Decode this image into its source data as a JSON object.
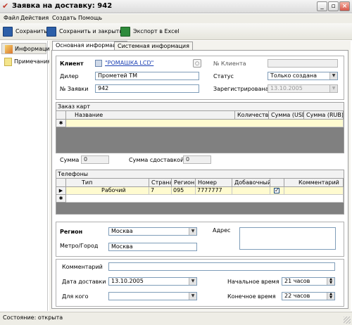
{
  "window": {
    "title": "Заявка на доставку: 942"
  },
  "menu": [
    "Файл",
    "Действия",
    "Создать",
    "Помощь"
  ],
  "toolbar": {
    "save": "Сохранить",
    "save_close": "Сохранить и закрыть",
    "export": "Экспорт в Excel"
  },
  "nav": {
    "items": [
      {
        "label": "Информация"
      },
      {
        "label": "Примечания"
      }
    ]
  },
  "tabs": [
    "Основная информация",
    "Системная информация"
  ],
  "main": {
    "client_label": "Клиент",
    "client_value": "\"РОМАШКА LCD\"",
    "client_no_label": "№ Клиента",
    "client_no_value": "",
    "dealer_label": "Дилер",
    "dealer_value": "Прометей ТМ",
    "status_label": "Статус",
    "status_value": "Только создана",
    "order_no_label": "№ Заявки",
    "order_no_value": "942",
    "registered_label": "Зарегистрирована",
    "registered_value": "13.10.2005"
  },
  "cards": {
    "caption": "Заказ карт",
    "columns": [
      "Название",
      "Количество",
      "Сумма (USD)",
      "Сумма (RUB)"
    ],
    "new_row_marker": "✱"
  },
  "sums": {
    "sum_label": "Сумма",
    "sum_value": "0",
    "delivery_label": "Сумма сдоставкой",
    "delivery_value": "0"
  },
  "phones": {
    "caption": "Телефоны",
    "columns": [
      "Тип",
      "Страна",
      "Регион",
      "Номер",
      "Добавочный",
      "",
      "Комментарий"
    ],
    "rows": [
      {
        "type": "Рабочий",
        "country": "7",
        "region": "095",
        "number": "7777777",
        "ext": "",
        "comment": ""
      }
    ],
    "current_row_marker": "▶",
    "new_row_marker": "✱"
  },
  "address": {
    "region_label": "Регион",
    "region_value": "Москва",
    "metro_label": "Метро/Город",
    "metro_value": "Москва",
    "address_label": "Адрес",
    "address_value": ""
  },
  "delivery": {
    "comment_label": "Комментарий",
    "comment_value": "",
    "date_label": "Дата доставки",
    "date_value": "13.10.2005",
    "for_label": "Для кого",
    "for_value": "",
    "start_label": "Начальное время",
    "start_value": "21 часов",
    "end_label": "Конечное время",
    "end_value": "22 часов"
  },
  "status": {
    "text": "Состояние: открыта"
  },
  "colors": {
    "accent": "#0a246a",
    "highlight_row": "#fffbd0",
    "grid_bg": "#808080"
  }
}
